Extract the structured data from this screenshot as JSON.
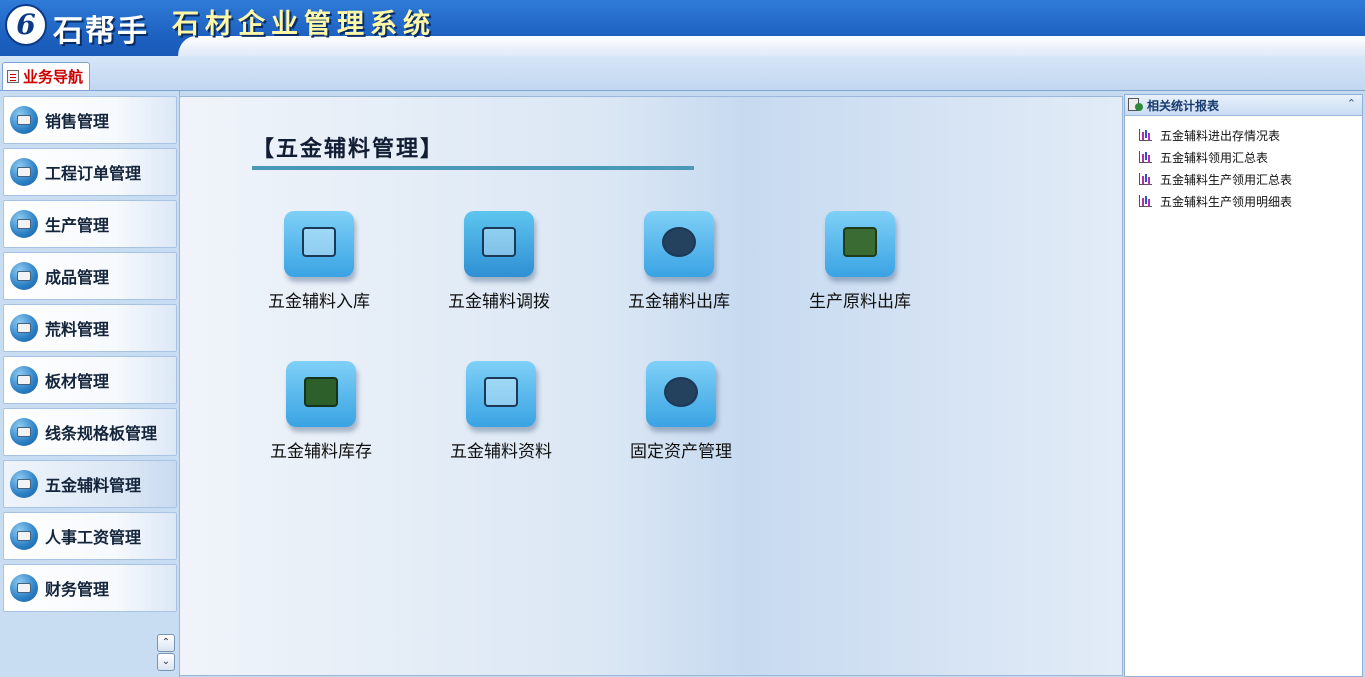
{
  "header": {
    "logo_char": "6",
    "brand": "石帮手",
    "app_title": "石材企业管理系统"
  },
  "tabs": [
    {
      "label": "业务导航",
      "icon": "notepad-icon",
      "active": true
    }
  ],
  "sidebar": {
    "items": [
      {
        "label": "销售管理",
        "icon": "sales-icon"
      },
      {
        "label": "工程订单管理",
        "icon": "project-order-icon"
      },
      {
        "label": "生产管理",
        "icon": "production-icon"
      },
      {
        "label": "成品管理",
        "icon": "finished-goods-icon"
      },
      {
        "label": "荒料管理",
        "icon": "raw-block-icon"
      },
      {
        "label": "板材管理",
        "icon": "slab-icon"
      },
      {
        "label": "线条规格板管理",
        "icon": "line-spec-icon"
      },
      {
        "label": "五金辅料管理",
        "icon": "hardware-icon",
        "active": true
      },
      {
        "label": "人事工资管理",
        "icon": "hr-payroll-icon"
      },
      {
        "label": "财务管理",
        "icon": "finance-icon"
      }
    ],
    "scroll_up": "⌃",
    "scroll_down": "⌄"
  },
  "main": {
    "title": "【五金辅料管理】",
    "tiles": [
      {
        "label": "五金辅料入库",
        "icon": "stock-in-icon"
      },
      {
        "label": "五金辅料调拨",
        "icon": "transfer-icon"
      },
      {
        "label": "五金辅料出库",
        "icon": "stock-out-icon"
      },
      {
        "label": "生产原料出库",
        "icon": "raw-material-out-icon"
      },
      {
        "label": "五金辅料库存",
        "icon": "inventory-icon"
      },
      {
        "label": "五金辅料资料",
        "icon": "material-info-icon"
      },
      {
        "label": "固定资产管理",
        "icon": "fixed-assets-icon"
      }
    ]
  },
  "right_panel": {
    "title": "相关统计报表",
    "collapse": "⌃",
    "reports": [
      {
        "label": "五金辅料进出存情况表"
      },
      {
        "label": "五金辅料领用汇总表"
      },
      {
        "label": "五金辅料生产领用汇总表"
      },
      {
        "label": "五金辅料生产领用明细表"
      }
    ]
  },
  "colors": {
    "header_blue": "#1c5fbf",
    "app_title_yellow": "#fff7a8",
    "tab_red": "#cc0000",
    "title_rule": "#4a98b8"
  }
}
